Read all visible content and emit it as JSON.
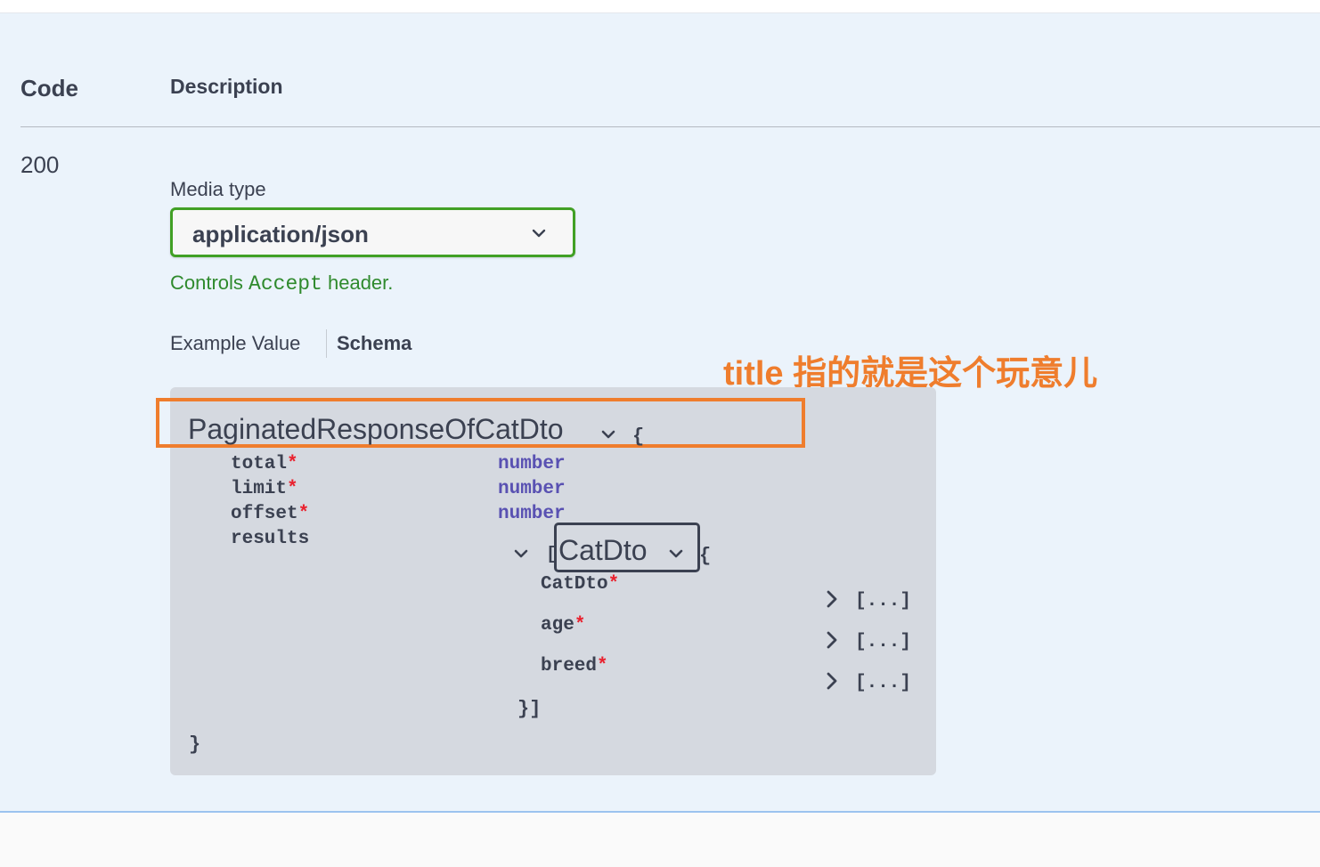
{
  "responses": {
    "headers": {
      "code": "Code",
      "description": "Description"
    },
    "row": {
      "code": "200",
      "media_type_label": "Media type",
      "media_type_value": "application/json",
      "controls_prefix": "Controls ",
      "controls_code": "Accept",
      "controls_suffix": " header.",
      "tabs": {
        "example_value": "Example Value",
        "schema": "Schema"
      }
    }
  },
  "annotation": {
    "text": "title 指的就是这个玩意儿",
    "color": "#ef7d2d"
  },
  "schema": {
    "model_title": "PaginatedResponseOfCatDto",
    "open_brace": "{",
    "close_brace": "}",
    "required_mark": "*",
    "properties": [
      {
        "name": "total",
        "required": "*",
        "type": "number"
      },
      {
        "name": "limit",
        "required": "*",
        "type": "number"
      },
      {
        "name": "offset",
        "required": "*",
        "type": "number"
      },
      {
        "name": "results",
        "required": ""
      }
    ],
    "results_array": {
      "open_bracket": "[",
      "item_title": "CatDto",
      "item_open_brace": "{",
      "close": "}]",
      "fields": [
        {
          "name": "CatDto",
          "required": "*",
          "collapsed": "[...]"
        },
        {
          "name": "age",
          "required": "*",
          "collapsed": "[...]"
        },
        {
          "name": "breed",
          "required": "*",
          "collapsed": "[...]"
        }
      ]
    }
  },
  "colors": {
    "panel_bg": "#ebf3fb",
    "select_border": "#41a025",
    "controls_text": "#2f8a2d",
    "type_text": "#5951b2",
    "required_star": "#e9212e",
    "annotation_box": "#ef7d2d"
  },
  "icons": {
    "select_chevron": "chevron-down-icon",
    "expand": "chevron-right-icon"
  }
}
